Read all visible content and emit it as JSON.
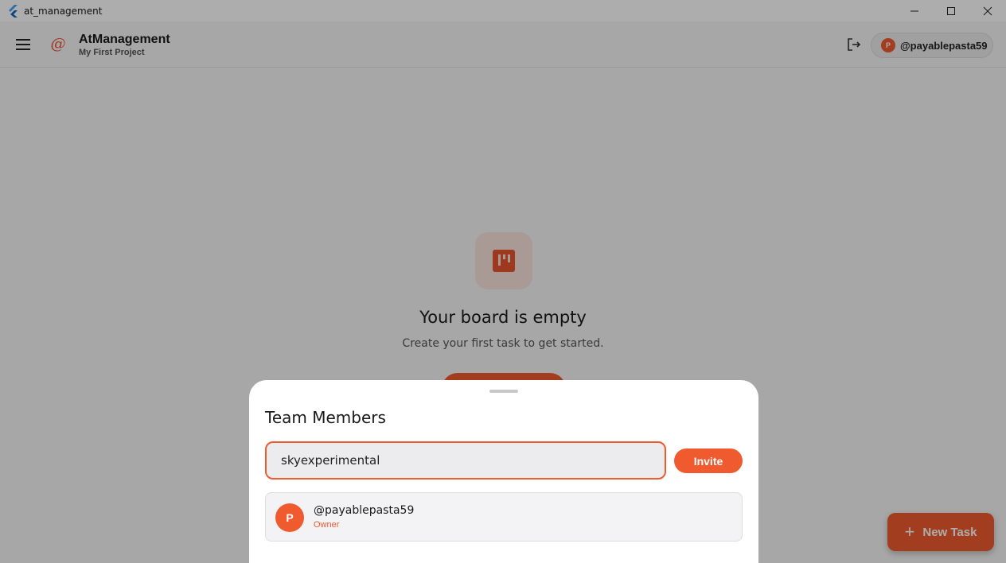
{
  "window": {
    "title": "at_management",
    "controls": [
      "minimize-icon",
      "maximize-icon",
      "close-icon"
    ]
  },
  "header": {
    "brand_title": "AtManagement",
    "project_name": "My First Project",
    "user_initial": "P",
    "user_handle": "@payablepasta59"
  },
  "empty_state": {
    "title": "Your board is empty",
    "subtitle": "Create your first task to get started."
  },
  "fab": {
    "label": "New Task"
  },
  "team_sheet": {
    "title": "Team Members",
    "invite_value": "skyexperimental",
    "invite_button": "Invite",
    "members": [
      {
        "initial": "P",
        "handle": "@payablepasta59",
        "role": "Owner"
      }
    ]
  },
  "colors": {
    "accent": "#ef5a2e",
    "surface": "#f6f6f7",
    "scrim": "rgba(0,0,0,0.32)"
  }
}
